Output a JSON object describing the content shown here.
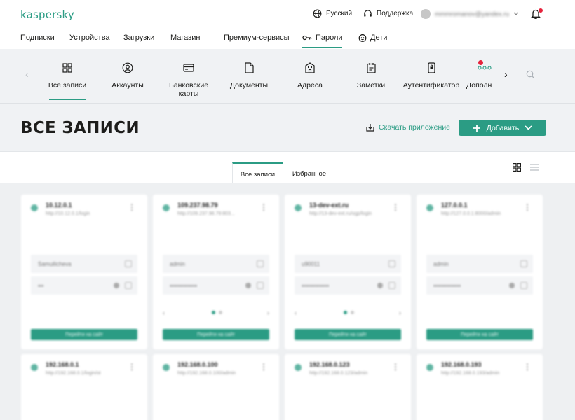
{
  "topbar": {
    "logo": "kaspersky",
    "language": "Русский",
    "support": "Поддержка",
    "account_email": "mmmromanov@yandex.ru"
  },
  "nav": {
    "items": [
      "Подписки",
      "Устройства",
      "Загрузки",
      "Магазин",
      "Премиум-сервисы",
      "Пароли",
      "Дети"
    ],
    "active": "Пароли"
  },
  "categories": {
    "items": [
      "Все записи",
      "Аккаунты",
      "Банковские карты",
      "Документы",
      "Адреса",
      "Заметки",
      "Аутентификатор",
      "Дополн"
    ],
    "active": "Все записи"
  },
  "header": {
    "title": "ВСЕ ЗАПИСИ",
    "download_label": "Скачать приложение",
    "add_label": "Добавить"
  },
  "tabs": {
    "all": "Все записи",
    "favorites": "Избранное"
  },
  "cards": [
    {
      "title": "10.12.0.1",
      "subtitle": "http://10.12.0.1/login",
      "login": "Samuilicheva",
      "password": "•••",
      "button": "Перейти на сайт"
    },
    {
      "title": "109.237.98.79",
      "subtitle": "http://109.237.98.79:803...",
      "login": "admin",
      "password": "••••••••••••••",
      "button": "Перейти на сайт"
    },
    {
      "title": "13-dev-ext.ru",
      "subtitle": "http://13-dev-ext.ru/ogp/login",
      "login": "u90011",
      "password": "••••••••••••••",
      "button": "Перейти на сайт"
    },
    {
      "title": "127.0.0.1",
      "subtitle": "http://127.0.0.1:8000/admin",
      "login": "admin",
      "password": "••••••••••••••",
      "button": "Перейти на сайт"
    },
    {
      "title": "192.168.0.1",
      "subtitle": "http://192.168.0.1/login/st",
      "login": "",
      "password": "",
      "button": ""
    },
    {
      "title": "192.168.0.100",
      "subtitle": "http://192.168.0.100/admin",
      "login": "",
      "password": "",
      "button": ""
    },
    {
      "title": "192.168.0.123",
      "subtitle": "http://192.168.0.123/admin",
      "login": "",
      "password": "",
      "button": ""
    },
    {
      "title": "192.168.0.193",
      "subtitle": "http://192.168.0.193/admin",
      "login": "",
      "password": "",
      "button": ""
    }
  ],
  "colors": {
    "accent": "#2b9c84",
    "notification": "#e6223b",
    "panel_bg": "#f0f2f4"
  }
}
